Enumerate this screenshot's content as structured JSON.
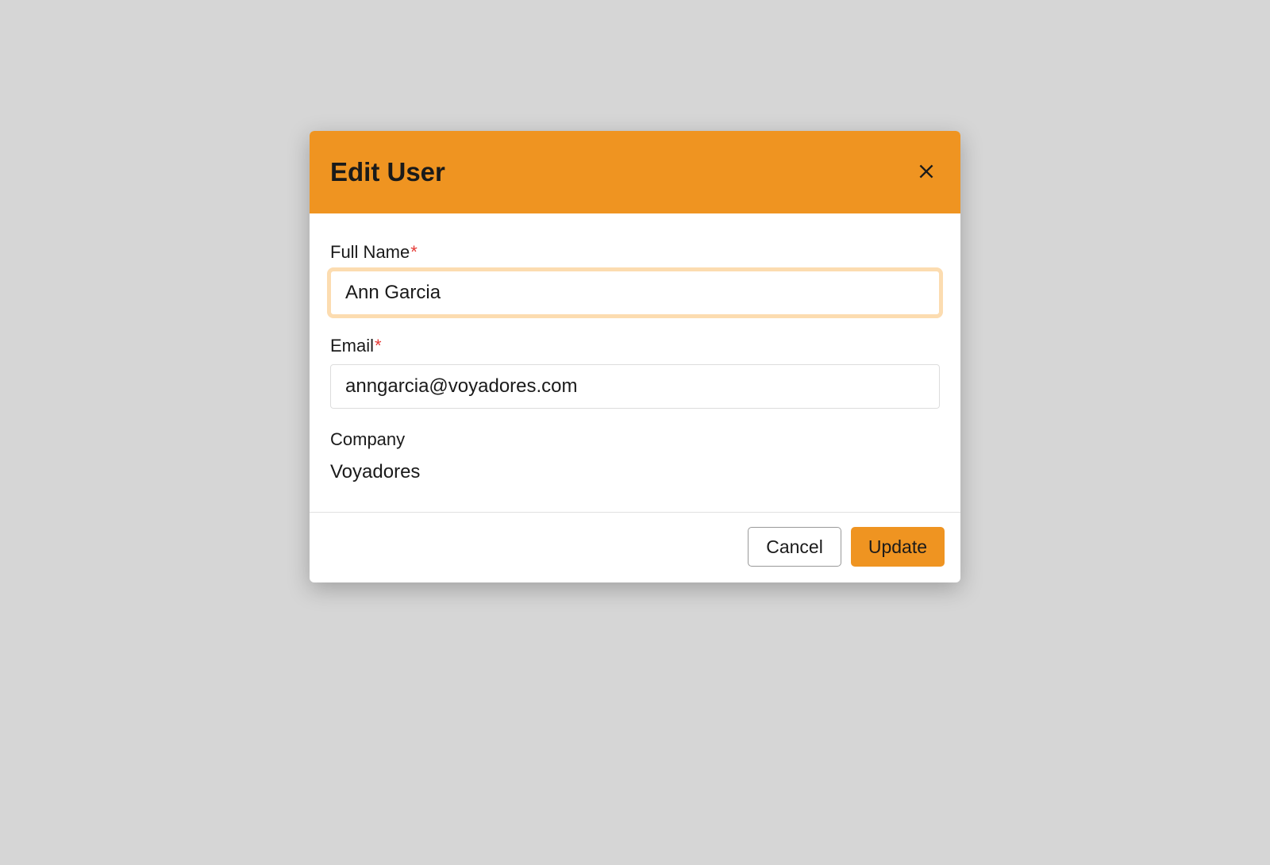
{
  "modal": {
    "title": "Edit User",
    "fields": {
      "full_name": {
        "label": "Full Name",
        "required": true,
        "value": "Ann Garcia"
      },
      "email": {
        "label": "Email",
        "required": true,
        "value": "anngarcia@voyadores.com"
      },
      "company": {
        "label": "Company",
        "value": "Voyadores"
      }
    },
    "actions": {
      "cancel": "Cancel",
      "update": "Update"
    }
  }
}
